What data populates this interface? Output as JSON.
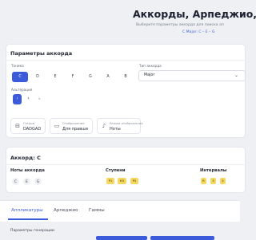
{
  "header": {
    "title": "Аккорды, Арпеджио, Г",
    "subtitle": "Выберите параметры аккорда для поиска ап",
    "subline": "C Major: C – E – G"
  },
  "params": {
    "title": "Параметры аккорда",
    "tonic_label": "Тоника",
    "keys": [
      "C",
      "D",
      "E",
      "F",
      "G",
      "A",
      "B"
    ],
    "active_key": "C",
    "chord_type_label": "Тип аккорда",
    "chord_type_value": "Major",
    "alteration_label": "Альтерация",
    "alterations": [
      "♮",
      "♯",
      "♭"
    ],
    "active_alteration": "♮",
    "options": [
      {
        "icon": "guitar-icon",
        "caption": "Гитара",
        "value": "DADGAD"
      },
      {
        "icon": "display-icon",
        "caption": "Отображение",
        "value": "Для правши"
      },
      {
        "icon": "music-note-icon",
        "caption": "Режим отображения",
        "value": "Ноты"
      }
    ]
  },
  "chord_info": {
    "title": "Аккорд: C",
    "notes_label": "Ноты аккорда",
    "notes": [
      "C",
      "E",
      "G"
    ],
    "steps_label": "Ступени",
    "steps": [
      "P1",
      "M3",
      "P5"
    ],
    "intervals_label": "Интервалы",
    "intervals": [
      "R",
      "3",
      "5"
    ]
  },
  "tabs": {
    "items": [
      "Аппликатуры",
      "Арпеджио",
      "Гаммы"
    ],
    "active": "Аппликатуры"
  },
  "generation": {
    "label": "Параметры генерации"
  },
  "colors": {
    "accent": "#3b5bdb",
    "badge": "#f6d860",
    "background": "#eef0f4"
  }
}
